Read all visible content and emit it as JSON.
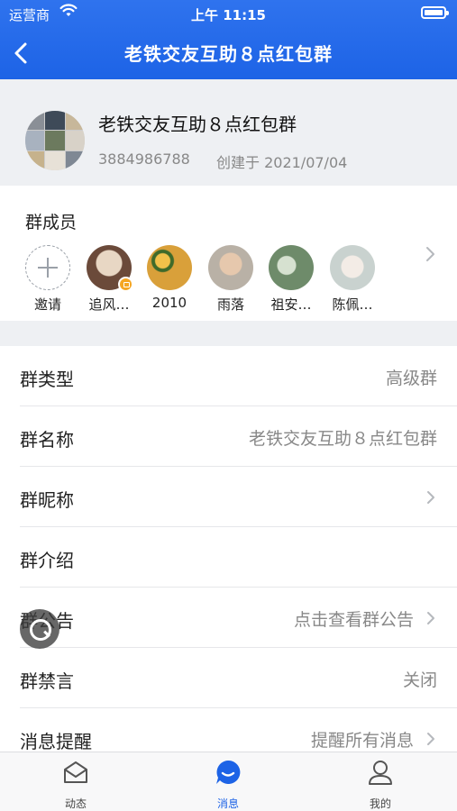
{
  "status_bar": {
    "carrier": "运营商",
    "time": "上午 11:15"
  },
  "nav": {
    "title": "老铁交友互助８点红包群"
  },
  "group": {
    "name": "老铁交友互助８点红包群",
    "id": "3884986788",
    "created": "创建于 2021/07/04"
  },
  "members": {
    "label": "群成员",
    "items": [
      {
        "name": "邀请",
        "type": "invite"
      },
      {
        "name": "追风…",
        "color": "#6b4a3a",
        "badge": true
      },
      {
        "name": "2010",
        "color": "#d9a03a"
      },
      {
        "name": "雨落",
        "color": "#b9b1a6"
      },
      {
        "name": "祖安…",
        "color": "#6e8b6a"
      },
      {
        "name": "陈佩…",
        "color": "#c9d2cf"
      }
    ]
  },
  "settings": [
    {
      "key": "群类型",
      "value": "高级群",
      "chevron": false
    },
    {
      "key": "群名称",
      "value": "老铁交友互助８点红包群",
      "chevron": false
    },
    {
      "key": "群昵称",
      "value": "",
      "chevron": true
    },
    {
      "key": "群介绍",
      "value": "",
      "chevron": false
    },
    {
      "key": "群公告",
      "value": "点击查看群公告",
      "chevron": true
    },
    {
      "key": "群禁言",
      "value": "关闭",
      "chevron": false
    },
    {
      "key": "消息提醒",
      "value": "提醒所有消息",
      "chevron": true
    }
  ],
  "tabbar": {
    "tabs": [
      {
        "label": "动态",
        "icon": "mail-icon"
      },
      {
        "label": "消息",
        "icon": "chat-bubble-icon",
        "active": true
      },
      {
        "label": "我的",
        "icon": "user-icon"
      }
    ]
  },
  "colors": {
    "primary": "#1d63e6",
    "accent_badge": "#f5a623"
  }
}
